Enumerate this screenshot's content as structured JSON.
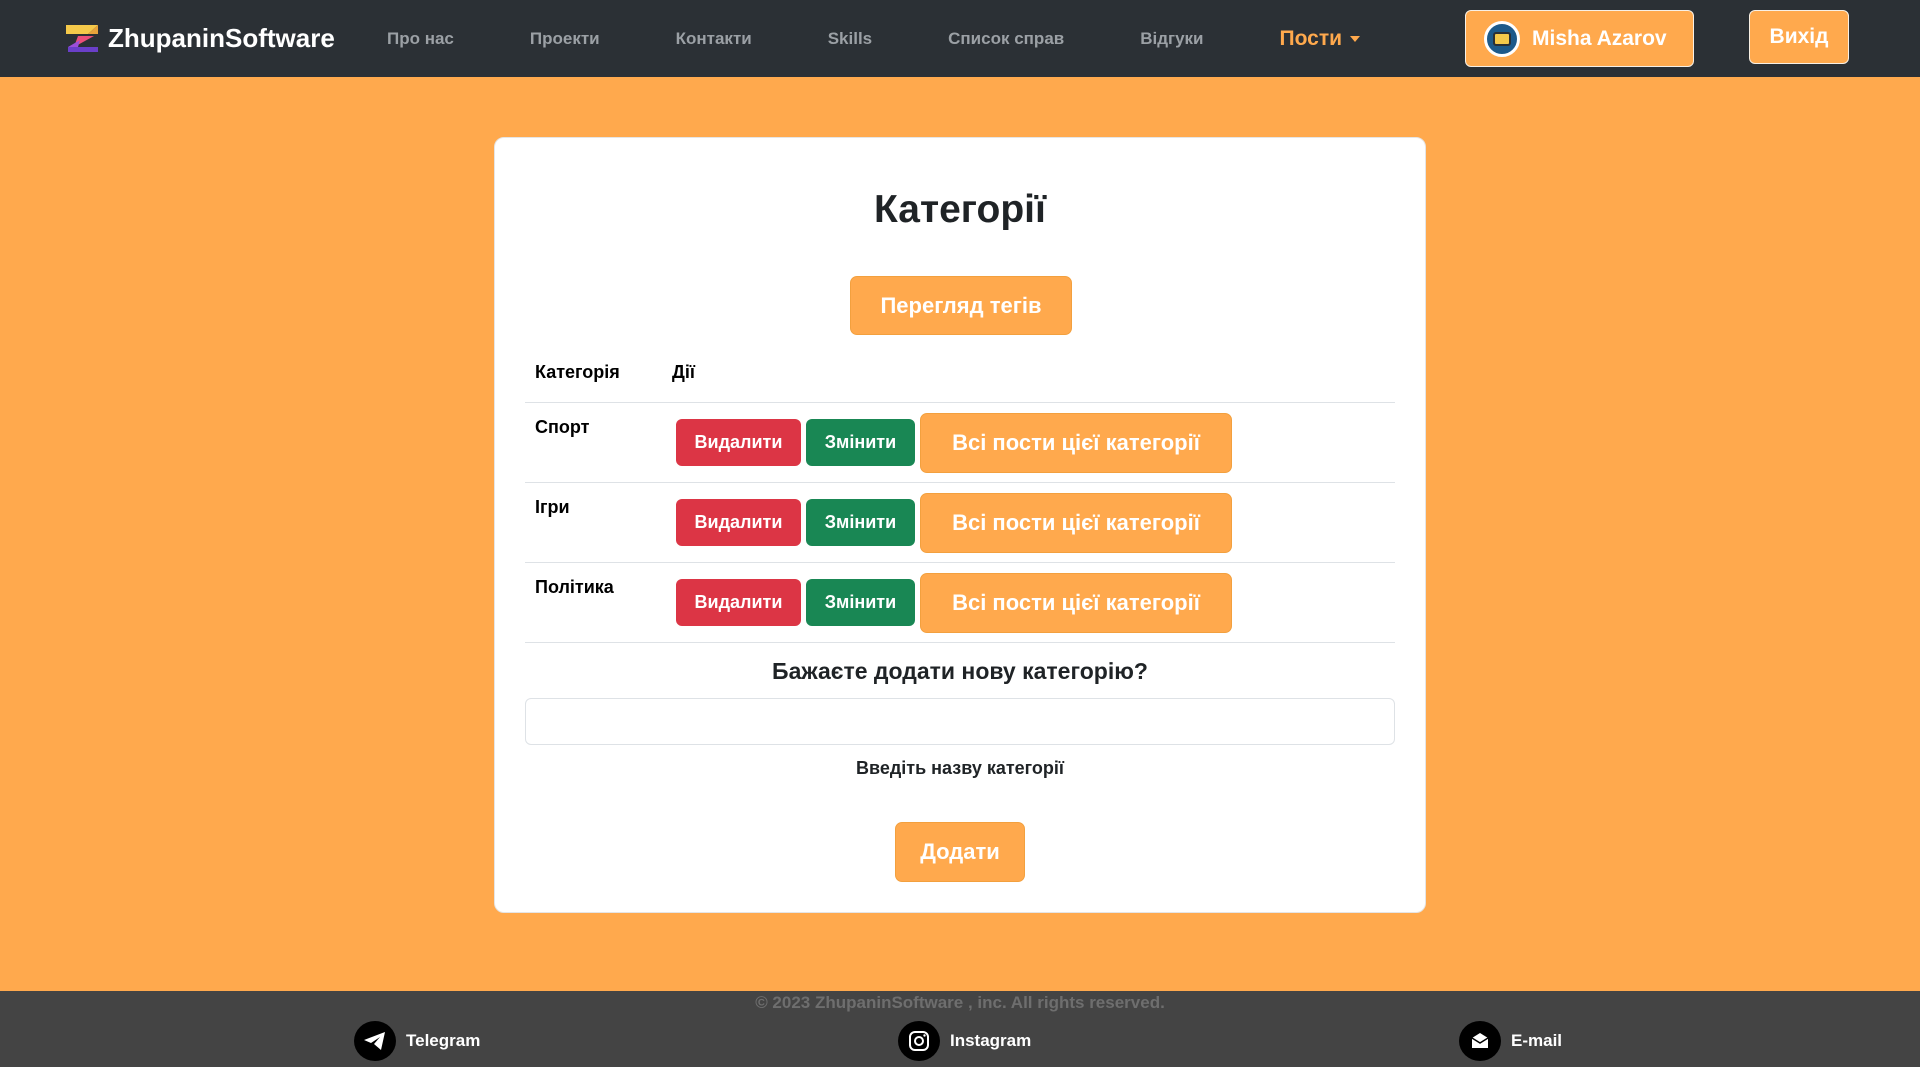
{
  "nav": {
    "brand": "ZhupaninSoftware",
    "links": [
      "Про нас",
      "Проекти",
      "Контакти",
      "Skills",
      "Список справ",
      "Відгуки"
    ],
    "posts_label": "Пости",
    "user_name": "Misha Azarov",
    "logout_label": "Вихід"
  },
  "page": {
    "title": "Категорії",
    "tags_button": "Перегляд тегів",
    "table": {
      "headers": [
        "Категорія",
        "Дії"
      ],
      "rows": [
        {
          "name": "Спорт",
          "delete": "Видалити",
          "edit": "Змінити",
          "all_posts": "Всі пости цієї категорії"
        },
        {
          "name": "Ігри",
          "delete": "Видалити",
          "edit": "Змінити",
          "all_posts": "Всі пости цієї категорії"
        },
        {
          "name": "Політика",
          "delete": "Видалити",
          "edit": "Змінити",
          "all_posts": "Всі пости цієї категорії"
        }
      ]
    },
    "add": {
      "title": "Бажаєте додати нову категорію?",
      "input_value": "",
      "label": "Введіть назву категорії",
      "button": "Додати"
    }
  },
  "footer": {
    "copyright": "© 2023 ZhupaninSoftware , inc. All rights reserved.",
    "links": [
      "Telegram",
      "Instagram",
      "E-mail"
    ]
  },
  "colors": {
    "accent": "#FFA94D",
    "navbar": "#2B3035",
    "danger": "#DC3545",
    "success": "#198754",
    "footer": "#444444"
  },
  "icons": {
    "brand": "zhupanin-logo-icon",
    "telegram": "telegram-icon",
    "instagram": "instagram-icon",
    "email": "email-icon",
    "avatar": "user-avatar-icon",
    "dropdown": "caret-down-icon"
  }
}
